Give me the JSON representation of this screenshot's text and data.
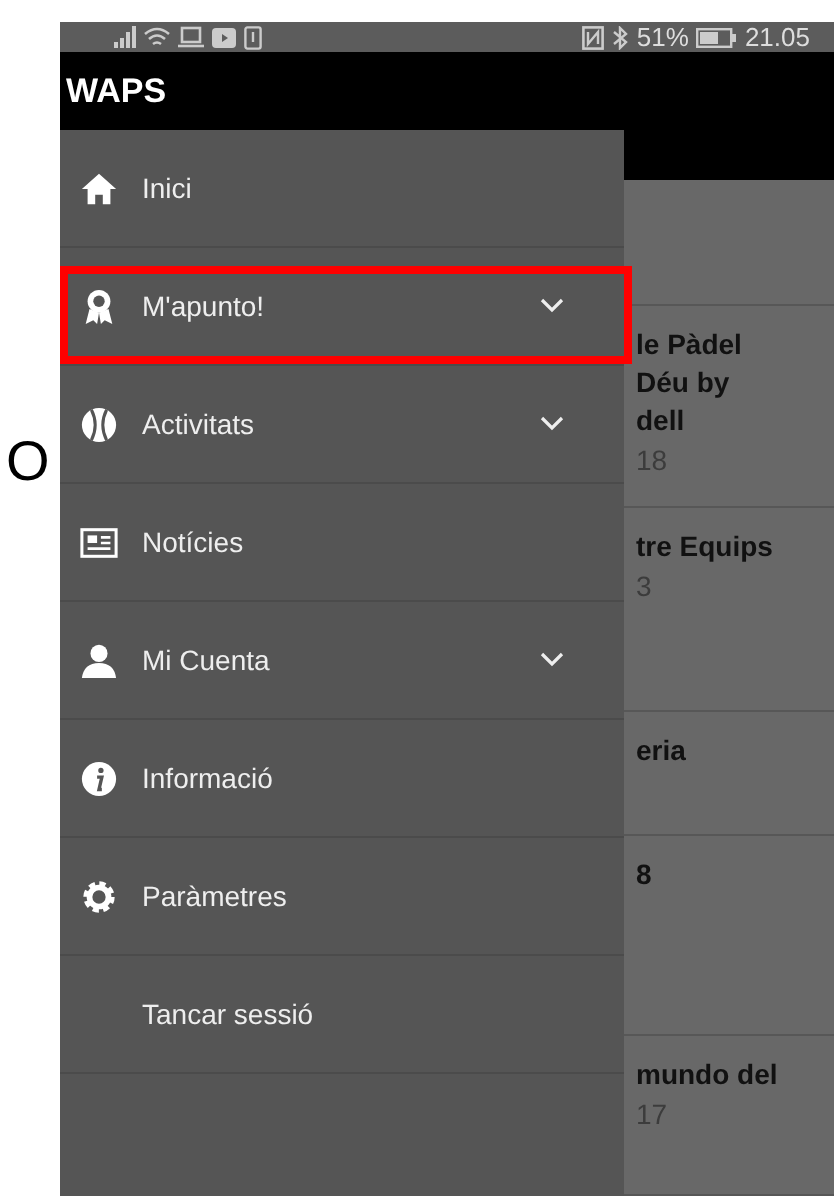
{
  "margin_letter": "O",
  "status_bar": {
    "battery": "51%",
    "time": "21.05"
  },
  "app_bar": {
    "title": "WAPS"
  },
  "menu": [
    {
      "label": "Inici",
      "expandable": false,
      "highlighted": false
    },
    {
      "label": "M'apunto!",
      "expandable": true,
      "highlighted": true
    },
    {
      "label": "Activitats",
      "expandable": true,
      "highlighted": false
    },
    {
      "label": "Notícies",
      "expandable": false,
      "highlighted": false
    },
    {
      "label": "Mi Cuenta",
      "expandable": true,
      "highlighted": false
    },
    {
      "label": "Informació",
      "expandable": false,
      "highlighted": false
    },
    {
      "label": "Paràmetres",
      "expandable": false,
      "highlighted": false
    },
    {
      "label": "Tancar sessió",
      "expandable": false,
      "highlighted": false
    }
  ],
  "background_list": [
    {
      "lines": [
        "le Pàdel",
        "Déu by",
        "dell"
      ],
      "date": "18"
    },
    {
      "lines": [
        "tre Equips"
      ],
      "date": "3"
    },
    {
      "lines": [
        "eria"
      ]
    },
    {
      "lines": [
        "8"
      ]
    },
    {
      "lines": [
        "mundo del"
      ],
      "date": "17"
    }
  ]
}
